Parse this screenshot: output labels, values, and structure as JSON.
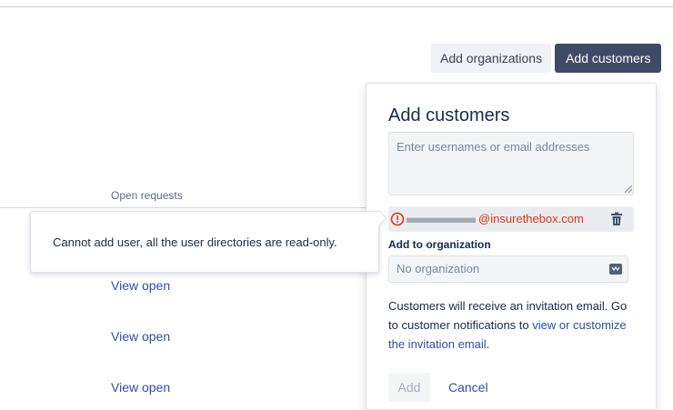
{
  "header": {
    "add_organizations_label": "Add organizations",
    "add_customers_label": "Add customers"
  },
  "table": {
    "column_header": "Open requests",
    "rows": [
      {
        "link": "View open"
      },
      {
        "link": "View open"
      },
      {
        "link": "View open"
      }
    ]
  },
  "tooltip": {
    "message": "Cannot add user, all the user directories are read-only."
  },
  "dialog": {
    "title": "Add customers",
    "input_placeholder": "Enter usernames or email addresses",
    "invalid_email_domain": "@insurethebox.com",
    "org_label": "Add to organization",
    "org_value": "No organization",
    "info_text": "Customers will receive an invitation email. Go to customer notifications to ",
    "info_link": "view or customize the invitation email",
    "info_end": ".",
    "add_label": "Add",
    "cancel_label": "Cancel"
  },
  "colors": {
    "primary_button": "#3f4a66",
    "link": "#2d4fa6",
    "error": "#de350b"
  },
  "icons": {
    "error": "error-icon",
    "delete": "trash-icon",
    "select": "select-icon"
  }
}
